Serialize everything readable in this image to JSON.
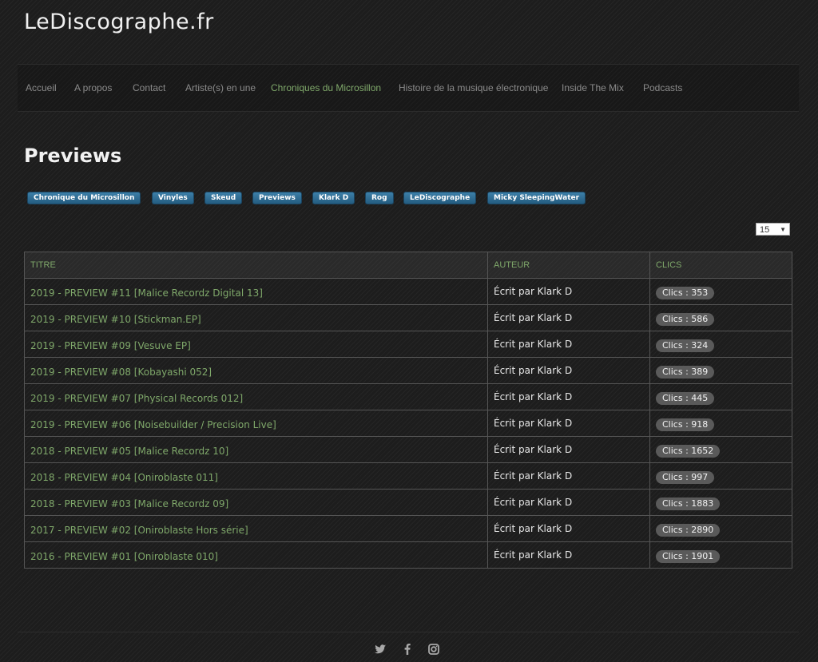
{
  "site": {
    "title": "LeDiscographe.fr"
  },
  "nav": {
    "items": [
      {
        "label": "Accueil"
      },
      {
        "label": "A propos"
      },
      {
        "label": "Contact"
      },
      {
        "label": "Artiste(s) en une"
      },
      {
        "label": "Chroniques du Microsillon",
        "active": true
      },
      {
        "label": "Histoire de la musique électronique"
      },
      {
        "label": "Inside The Mix"
      },
      {
        "label": "Podcasts"
      }
    ]
  },
  "page": {
    "title": "Previews"
  },
  "tags": [
    {
      "label": "Chronique du Microsillon"
    },
    {
      "label": "Vinyles"
    },
    {
      "label": "Skeud"
    },
    {
      "label": "Previews"
    },
    {
      "label": "Klark D"
    },
    {
      "label": "Rog"
    },
    {
      "label": "LeDiscographe"
    },
    {
      "label": "Micky SleepingWater"
    }
  ],
  "list_limit": {
    "value": "15"
  },
  "table": {
    "headers": {
      "title": "TITRE",
      "author": "AUTEUR",
      "hits": "CLICS"
    },
    "rows": [
      {
        "title": "2019 - PREVIEW #11 [Malice Recordz Digital 13]",
        "author": "Écrit par Klark D",
        "hits": "Clics : 353"
      },
      {
        "title": "2019 - PREVIEW #10 [Stickman.EP]",
        "author": "Écrit par Klark D",
        "hits": "Clics : 586"
      },
      {
        "title": "2019 - PREVIEW #09 [Vesuve EP]",
        "author": "Écrit par Klark D",
        "hits": "Clics : 324"
      },
      {
        "title": "2019 - PREVIEW #08 [Kobayashi 052]",
        "author": "Écrit par Klark D",
        "hits": "Clics : 389"
      },
      {
        "title": "2019 - PREVIEW #07 [Physical Records 012]",
        "author": "Écrit par Klark D",
        "hits": "Clics : 445"
      },
      {
        "title": "2019 - PREVIEW #06 [Noisebuilder / Precision Live]",
        "author": "Écrit par Klark D",
        "hits": "Clics : 918"
      },
      {
        "title": "2018 - PREVIEW #05 [Malice Recordz 10]",
        "author": "Écrit par Klark D",
        "hits": "Clics : 1652"
      },
      {
        "title": "2018 - PREVIEW #04 [Oniroblaste 011]",
        "author": "Écrit par Klark D",
        "hits": "Clics : 997"
      },
      {
        "title": "2018 - PREVIEW #03 [Malice Recordz 09]",
        "author": "Écrit par Klark D",
        "hits": "Clics : 1883"
      },
      {
        "title": "2017 - PREVIEW #02 [Oniroblaste Hors série]",
        "author": "Écrit par Klark D",
        "hits": "Clics : 2890"
      },
      {
        "title": "2016 - PREVIEW #01 [Oniroblaste 010]",
        "author": "Écrit par Klark D",
        "hits": "Clics : 1901"
      }
    ]
  },
  "footer": {
    "social": [
      {
        "icon": "twitter-icon"
      },
      {
        "icon": "facebook-icon"
      },
      {
        "icon": "instagram-icon"
      }
    ]
  },
  "colors": {
    "accent": "#7fa86a",
    "tag": "#2f6d94",
    "background": "#1d1d1d"
  }
}
